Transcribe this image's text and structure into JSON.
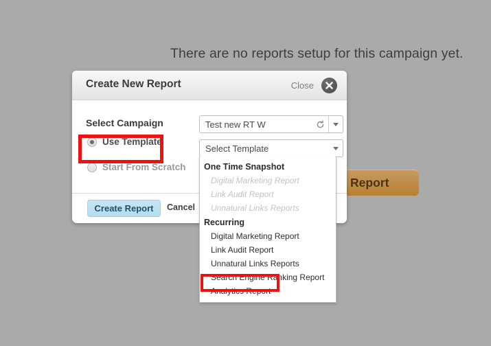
{
  "page": {
    "empty_message": "There are no reports setup for this campaign yet.",
    "request_report_button": "st Report",
    "background_color": "#aaaaaa"
  },
  "modal": {
    "title": "Create New Report",
    "close_label": "Close",
    "close_icon": "close-circle-icon",
    "fields": {
      "select_campaign_label": "Select Campaign",
      "campaign_select": {
        "value": "Test new RT W",
        "refresh_icon": "refresh-icon",
        "arrow_icon": "chevron-down-icon"
      },
      "template_select": {
        "value": "Select Template",
        "arrow_icon": "chevron-down-icon"
      }
    },
    "radios": [
      {
        "label": "Use Template",
        "checked": true,
        "disabled": false
      },
      {
        "label": "Start From Scratch",
        "checked": false,
        "disabled": true
      }
    ],
    "footer": {
      "create_label": "Create Report",
      "cancel_label": "Cancel",
      "create_button_color": "#b3dcef"
    }
  },
  "template_dropdown": {
    "groups": [
      {
        "label": "One Time Snapshot",
        "items": [
          {
            "label": "Digital Marketing Report",
            "disabled": true
          },
          {
            "label": "Link Audit Report",
            "disabled": true
          },
          {
            "label": "Unnatural Links Reports",
            "disabled": true
          }
        ]
      },
      {
        "label": "Recurring",
        "items": [
          {
            "label": "Digital Marketing Report",
            "disabled": false
          },
          {
            "label": "Link Audit Report",
            "disabled": false
          },
          {
            "label": "Unnatural Links Reports",
            "disabled": false
          },
          {
            "label": "Search Engine Ranking Report",
            "disabled": false
          },
          {
            "label": "Analytics Report",
            "disabled": false,
            "highlighted": true
          }
        ]
      }
    ]
  },
  "annotations": {
    "color": "#ee1111",
    "boxes": [
      {
        "target": "use-template-radio"
      },
      {
        "target": "analytics-report-item"
      }
    ]
  }
}
